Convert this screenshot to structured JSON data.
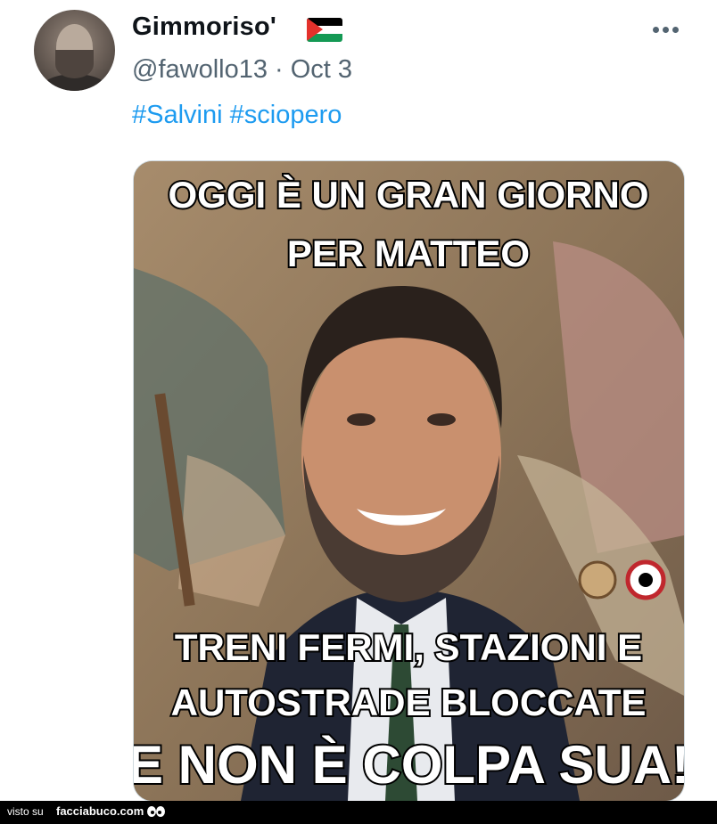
{
  "tweet": {
    "display_name": "Gimmoriso'",
    "handle_date": "@fawollo13 · Oct 3",
    "hashtags": [
      "#Salvini",
      "#sciopero"
    ],
    "more_icon": "more-horizontal-icon",
    "flag_icon": "palestine-flag-icon"
  },
  "image": {
    "top_text": [
      "OGGI È UN GRAN GIORNO",
      "PER MATTEO"
    ],
    "bottom_text": [
      "TRENI FERMI, STAZIONI E",
      "AUTOSTRADE BLOCCATE",
      "E NON È COLPA SUA!"
    ]
  },
  "footer": {
    "visto": "visto su",
    "brand": "facciabuco.com"
  },
  "colors": {
    "link": "#1d9bf0",
    "muted": "#536471",
    "text": "#0f1419"
  }
}
